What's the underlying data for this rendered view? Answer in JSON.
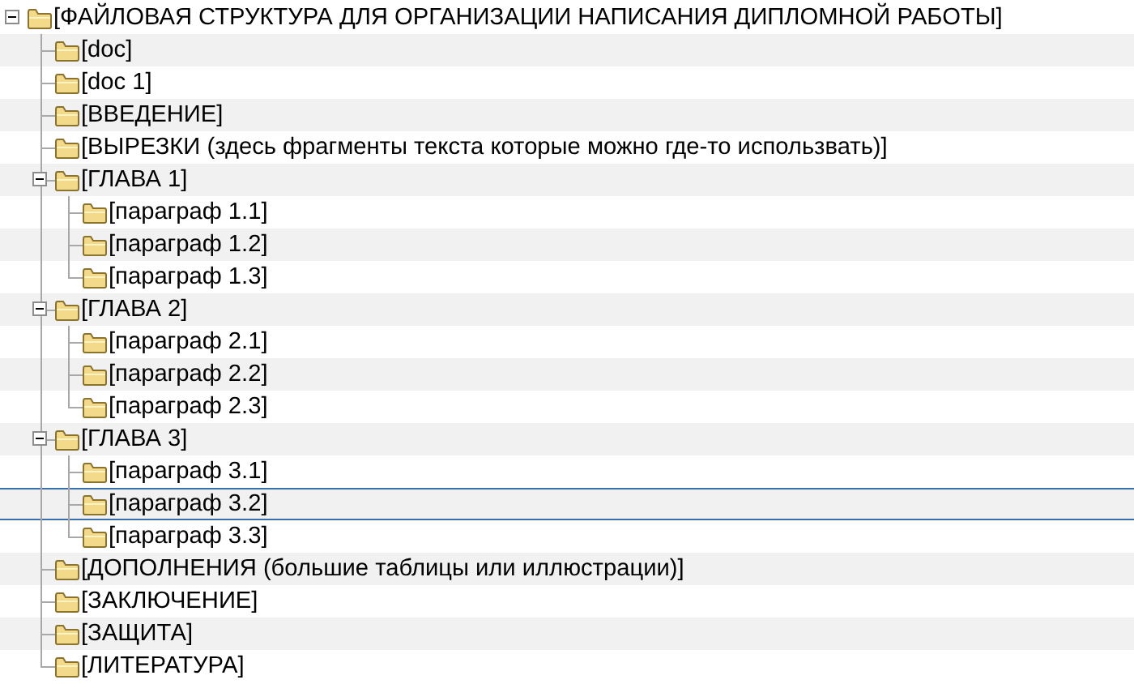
{
  "tree": [
    {
      "label": "[ФАЙЛОВАЯ СТРУКТУРА ДЛЯ ОРГАНИЗАЦИИ НАПИСАНИЯ ДИПЛОМНОЙ РАБОТЫ]",
      "expanded": true,
      "selected": false,
      "children": [
        {
          "label": "[doc]",
          "selected": false
        },
        {
          "label": "[doc 1]",
          "selected": false
        },
        {
          "label": "[ВВЕДЕНИЕ]",
          "selected": false
        },
        {
          "label": "[ВЫРЕЗКИ (здесь фрагменты текста которые можно где-то использвать)]",
          "selected": false
        },
        {
          "label": "[ГЛАВА 1]",
          "expanded": true,
          "selected": false,
          "children": [
            {
              "label": "[параграф 1.1]",
              "selected": false
            },
            {
              "label": "[параграф 1.2]",
              "selected": false
            },
            {
              "label": "[параграф 1.3]",
              "selected": false
            }
          ]
        },
        {
          "label": "[ГЛАВА 2]",
          "expanded": true,
          "selected": false,
          "children": [
            {
              "label": "[параграф 2.1]",
              "selected": false
            },
            {
              "label": "[параграф 2.2]",
              "selected": false
            },
            {
              "label": "[параграф 2.3]",
              "selected": false
            }
          ]
        },
        {
          "label": "[ГЛАВА 3]",
          "expanded": true,
          "selected": false,
          "children": [
            {
              "label": "[параграф 3.1]",
              "selected": false
            },
            {
              "label": "[параграф 3.2]",
              "selected": true
            },
            {
              "label": "[параграф 3.3]",
              "selected": false
            }
          ]
        },
        {
          "label": "[ДОПОЛНЕНИЯ (большие таблицы или иллюстрации)]",
          "selected": false
        },
        {
          "label": "[ЗАКЛЮЧЕНИЕ]",
          "selected": false
        },
        {
          "label": "[ЗАЩИТА]",
          "selected": false
        },
        {
          "label": "[ЛИТЕРАТУРА]",
          "selected": false
        }
      ]
    }
  ]
}
